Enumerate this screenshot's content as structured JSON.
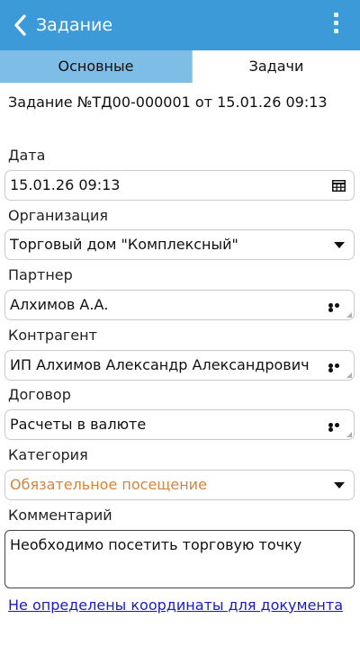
{
  "header": {
    "title": "Задание",
    "back_icon": "chevron-left-icon",
    "menu_icon": "more-vertical-icon",
    "accent_color": "#3d9ad9"
  },
  "tabs": [
    {
      "label": "Основные",
      "active": true
    },
    {
      "label": "Задачи",
      "active": false
    }
  ],
  "document_title": "Задание №ТД00-000001 от 15.01.26 09:13",
  "fields": {
    "date": {
      "label": "Дата",
      "value": "15.01.26 09:13",
      "icon": "calendar-icon"
    },
    "organization": {
      "label": "Организация",
      "value": "Торговый дом \"Комплексный\"",
      "icon": "dropdown-arrow-icon"
    },
    "partner": {
      "label": "Партнер",
      "value": "Алхимов А.А.",
      "icon": "more-horizontal-icon"
    },
    "counterparty": {
      "label": "Контрагент",
      "value": "ИП Алхимов Александр Александрович",
      "icon": "more-horizontal-icon"
    },
    "contract": {
      "label": "Договор",
      "value": "Расчеты в валюте",
      "icon": "more-horizontal-icon"
    },
    "category": {
      "label": "Категория",
      "value": "Обязательное посещение",
      "icon": "dropdown-arrow-icon",
      "value_color": "#d8833a"
    },
    "comment": {
      "label": "Комментарий",
      "value": "Необходимо посетить торговую точку"
    }
  },
  "coordinates_link": "Не определены координаты для документа"
}
